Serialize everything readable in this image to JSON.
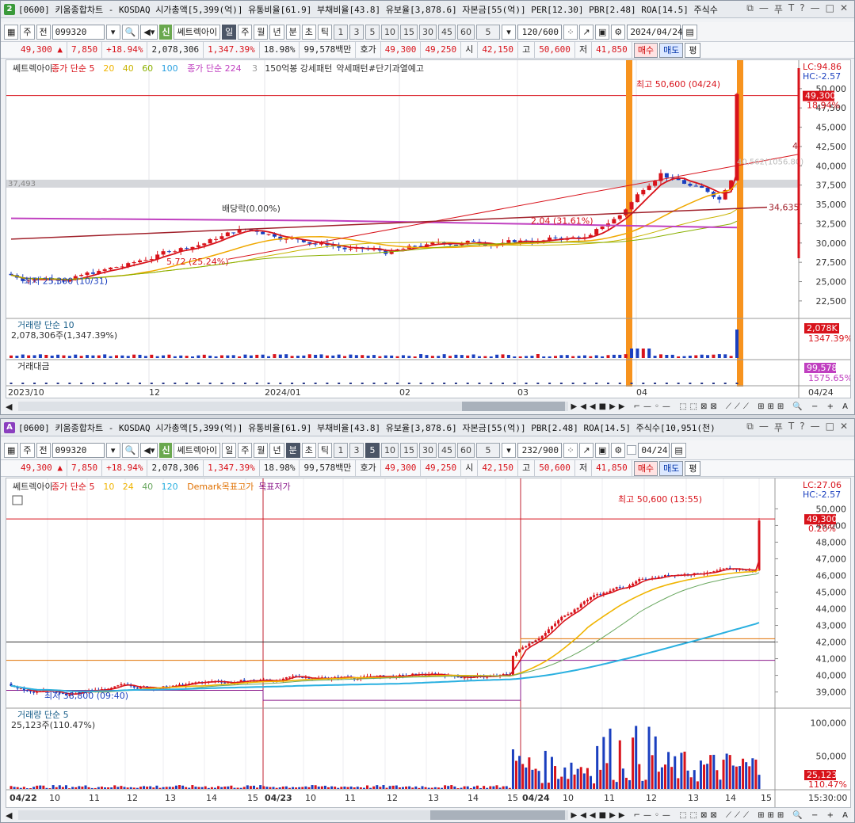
{
  "windows": [
    {
      "id": "top",
      "badge": "2",
      "badge_color": "#3a9a3a",
      "title": "[0600] 키움종합차트 - KOSDAQ 시가총액[5,399(억)] 유통비율[61.9] 부채비율[43.8] 유보율[3,878.6] 자본금[55(억)] PER[12.30] PBR[2.48] ROA[14.5] 주식수",
      "window_icons": [
        "⧉",
        "—",
        "푸",
        "T",
        "?",
        "—",
        "□",
        "✕"
      ],
      "toolbar": {
        "period_buttons": [
          "일",
          "주",
          "월",
          "년",
          "분",
          "초",
          "틱"
        ],
        "selected_period": "일",
        "interval_buttons": [
          "1",
          "3",
          "5",
          "10",
          "15",
          "30",
          "45",
          "60"
        ],
        "interval_select": "5",
        "count": "120/600",
        "date": "2024/04/24",
        "code": "099320",
        "type1": "주",
        "type2": "전",
        "sin": "신",
        "name": "쎄트렉아이"
      },
      "quote": {
        "price": "49,300 ▲",
        "change": "7,850",
        "pct": "+18.94%",
        "volume": "2,078,306",
        "vol_pct": "1,347.39%",
        "turnover": "18.98%",
        "amount": "99,578백만",
        "hoga_label": "호가",
        "ask": "49,300",
        "bid": "49,250",
        "open_label": "시",
        "open": "42,150",
        "high_label": "고",
        "high": "50,600",
        "low_label": "저",
        "low": "41,850",
        "buy": "매수",
        "sell": "매도",
        "flat": "평"
      },
      "legend": [
        "쎄트렉아이",
        "종가 단순 5",
        "20",
        "40",
        "60",
        "100",
        "종가 단순 224",
        "3",
        "150억봉 강세패턴",
        "약세패턴",
        "#단기과열예고"
      ],
      "legend_colors": [
        "#333",
        "#d8131b",
        "#f0b400",
        "#c8b400",
        "#8ab000",
        "#2aa0e0",
        "#c040c0",
        "#999",
        "#333",
        "#333",
        "#333"
      ],
      "price_axis": [
        "50,000",
        "47,500",
        "45,000",
        "42,500",
        "40,000",
        "37,500",
        "35,000",
        "32,500",
        "30,000",
        "27,500",
        "25,000",
        "22,500"
      ],
      "annotations": {
        "high": "최고 50,600 (04/24)",
        "low": "최저 25,300 (10/31)",
        "ex_div": "배당락(0.00%)",
        "pct1": "5.72 (25.24%)",
        "pct2": "2.04 (31.61%)",
        "line_lbl": "34,635",
        "left_lbl": "37,493",
        "lc": "LC:94.86",
        "hc": "HC:-2.57",
        "cur_price": "49,300",
        "cur_pct": "18.94%",
        "right_mid": "40,562(1056.80)",
        "right_tr": "4"
      },
      "volume_panel": {
        "title": "거래량",
        "ma": "단순 10",
        "value": "2,078,306주(1,347.39%)",
        "right_val": "2,078K",
        "right_pct": "1347.39%"
      },
      "amount_panel": {
        "title": "거래대금",
        "right_val": "99,578",
        "right_pct": "1575.65%"
      },
      "x_axis": [
        "2023/10",
        "12",
        "2024/01",
        "02",
        "03",
        "04",
        "04/24"
      ]
    },
    {
      "id": "bottom",
      "badge": "A",
      "badge_color": "#8b3fbf",
      "title": "[0600] 키움종합차트 - KOSDAQ 시가총액[5,399(억)] 유통비율[61.9] 부채비율[43.8] 유보율[3,878.6] 자본금[55(억)] PBR[2.48] ROA[14.5] 주식수[10,951(천)",
      "window_icons": [
        "⧉",
        "—",
        "푸",
        "T",
        "?",
        "—",
        "□",
        "✕"
      ],
      "toolbar": {
        "period_buttons": [
          "일",
          "주",
          "월",
          "년",
          "분",
          "초",
          "틱"
        ],
        "selected_period": "분",
        "interval_buttons": [
          "1",
          "3",
          "5",
          "10",
          "15",
          "30",
          "45",
          "60"
        ],
        "selected_interval": "5",
        "interval_select": "5",
        "count": "232/900",
        "date": "04/24",
        "code": "099320",
        "type1": "주",
        "type2": "전",
        "sin": "신",
        "name": "쎄트렉아이"
      },
      "quote": {
        "price": "49,300 ▲",
        "change": "7,850",
        "pct": "+18.94%",
        "volume": "2,078,306",
        "vol_pct": "1,347.39%",
        "turnover": "18.98%",
        "amount": "99,578백만",
        "hoga_label": "호가",
        "ask": "49,300",
        "bid": "49,250",
        "open_label": "시",
        "open": "42,150",
        "high_label": "고",
        "high": "50,600",
        "low_label": "저",
        "low": "41,850",
        "buy": "매수",
        "sell": "매도",
        "flat": "평"
      },
      "legend": [
        "쎄트렉아이",
        "종가 단순 5",
        "10",
        "24",
        "40",
        "120",
        "Demark목표고가",
        "목표저가"
      ],
      "legend_colors": [
        "#333",
        "#d8131b",
        "#f0b400",
        "#f0b400",
        "#6aa860",
        "#2ab0e0",
        "#e07000",
        "#8b1a8b"
      ],
      "price_axis": [
        "50,000",
        "49,000",
        "48,000",
        "47,000",
        "46,000",
        "45,000",
        "44,000",
        "43,000",
        "42,000",
        "41,000",
        "40,000",
        "39,000"
      ],
      "annotations": {
        "high": "최고 50,600 (13:55)",
        "low": "최저 38,800 (09:40)",
        "lc": "LC:27.06",
        "hc": "HC:-2.57",
        "cur_price": "49,300",
        "cur_pct": "0.20%"
      },
      "volume_panel": {
        "title": "거래량",
        "ma": "단순 5",
        "value": "25,123주(110.47%)",
        "axis": [
          "100,000",
          "50,000"
        ],
        "right_val": "25,123",
        "right_pct": "110.47%"
      },
      "x_axis": [
        "04/22",
        "10",
        "11",
        "12",
        "13",
        "14",
        "15",
        "04/23",
        "10",
        "11",
        "12",
        "13",
        "14",
        "15",
        "04/24",
        "10",
        "11",
        "12",
        "13",
        "14",
        "15",
        "15:30:00"
      ]
    }
  ],
  "colors": {
    "up": "#d8131b",
    "down": "#1a3fbf",
    "ma5": "#d8131b",
    "ma20": "#f0a800",
    "ma60": "#8ab000",
    "ma224": "#c040c0",
    "highlight": "#f7931e"
  }
}
